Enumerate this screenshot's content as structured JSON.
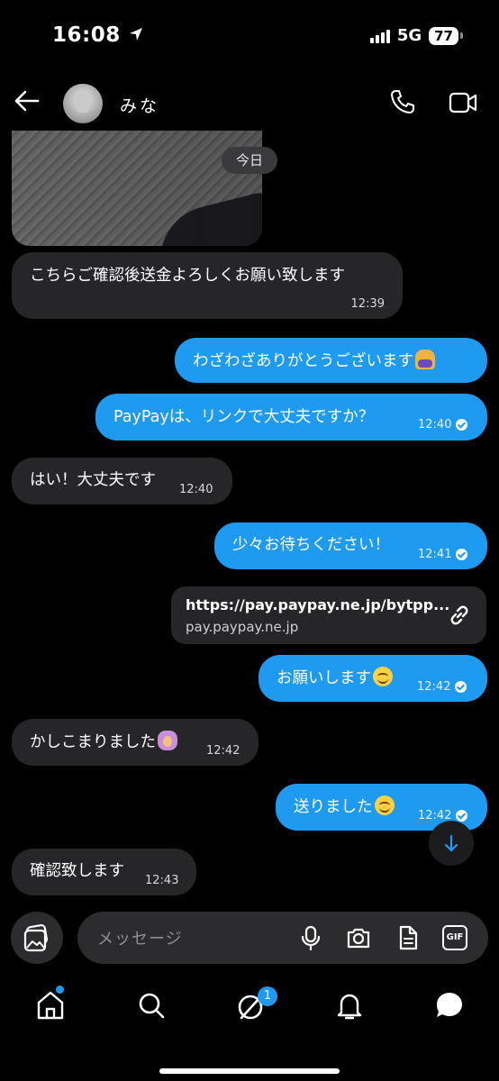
{
  "status_bar": {
    "time": "16:08",
    "network": "5G",
    "battery": "77"
  },
  "header": {
    "name": "みな"
  },
  "date_divider": "今日",
  "messages": [
    {
      "side": "in",
      "text": "こちらご確認後送金よろしくお願い致します",
      "time": "12:39"
    },
    {
      "side": "out",
      "text": "わざわざありがとうございます",
      "emoji": "person-bowing"
    },
    {
      "side": "out",
      "text": "PayPayは、リンクで大丈夫ですか？",
      "time": "12:40",
      "read": true
    },
    {
      "side": "in",
      "text": "はい！大丈夫です",
      "time": "12:40"
    },
    {
      "side": "out",
      "text": "少々お待ちください！",
      "time": "12:41",
      "read": true
    },
    {
      "side": "out",
      "text": "お願いします",
      "emoji": "smiling-face",
      "time": "12:42",
      "read": true
    },
    {
      "side": "in",
      "text": "かしこまりました",
      "emoji": "woman-gesturing-ok",
      "time": "12:42"
    },
    {
      "side": "out",
      "text": "送りました",
      "emoji": "smiling-face",
      "time": "12:42",
      "read": true
    },
    {
      "side": "in",
      "text": "確認致します",
      "time": "12:43"
    }
  ],
  "link_card": {
    "url": "https://pay.paypay.ne.jp/bytpp...",
    "host": "pay.paypay.ne.jp"
  },
  "composer": {
    "placeholder": "メッセージ",
    "gif_label": "GIF"
  },
  "nav": {
    "badge_count": "1"
  },
  "colors": {
    "outgoing": "#1e9bf0",
    "incoming": "#262628",
    "background": "#000000"
  }
}
